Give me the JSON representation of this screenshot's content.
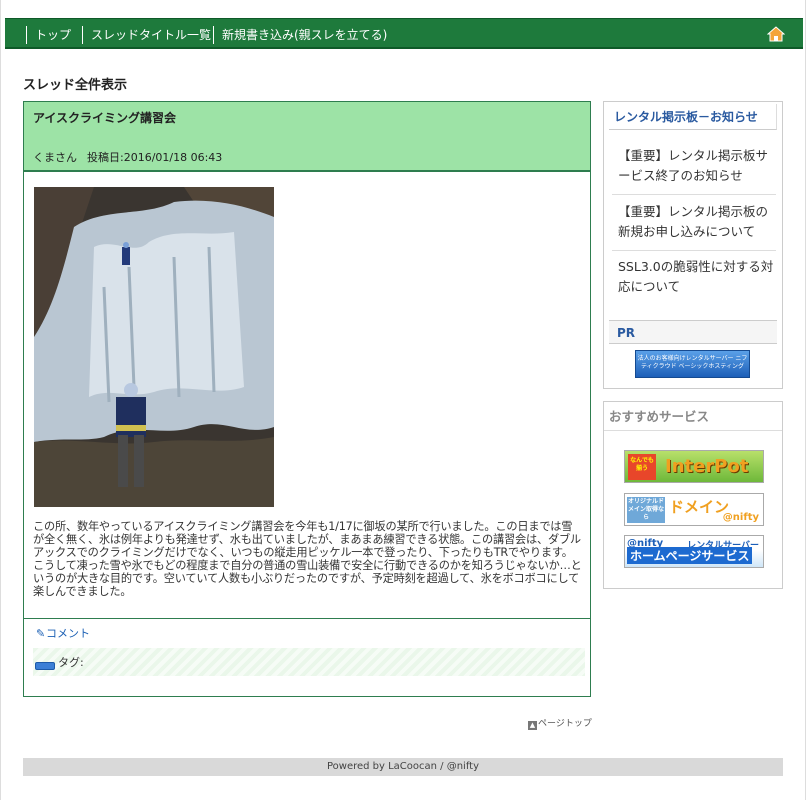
{
  "nav": {
    "items": [
      "トップ",
      "スレッドタイトル一覧",
      "新規書き込み(親スレを立てる)"
    ],
    "home_icon": "home-icon"
  },
  "page": {
    "heading": "スレッド全件表示"
  },
  "thread": {
    "title": "アイスクライミング講習会",
    "author": "くまさん",
    "posted_label": "投稿日:2016/01/18 06:43",
    "body": "この所、数年やっているアイスクライミング講習会を今年も1/17に御坂の某所で行いました。この日までは雪が全く無く、氷は例年よりも発達せず、水も出ていましたが、まあまあ練習できる状態。この講習会は、ダブルアックスでのクライミングだけでなく、いつもの縦走用ピッケル一本で登ったり、下ったりもTRでやります。こうして凍った雪や氷でもどの程度まで自分の普通の雪山装備で安全に行動できるのかを知ろうじゃないか…というのが大きな目的です。空いていて人数も小ぶりだったのですが、予定時刻を超過して、氷をボコボコにして楽しんできました。",
    "comment_label": "コメント",
    "tag_label": "タグ:"
  },
  "pagetop_label": "ページトップ",
  "sidebar": {
    "notice_title": "レンタル掲示板－お知らせ",
    "notices": [
      "【重要】レンタル掲示板サービス終了のお知らせ",
      "【重要】レンタル掲示板の新規お申し込みについて",
      "SSL3.0の脆弱性に対する対応について"
    ],
    "pr_title": "PR",
    "pr_banner_text": "法人のお客様向けレンタルサーバー ニフティクラウド ベーシックホスティング",
    "recommend_title": "おすすめサービス",
    "banners": {
      "interpot": {
        "badge": "なんでも揃う",
        "text": "InterPot"
      },
      "domain": {
        "left": "オリジナルドメイン取得なら",
        "text": "ドメイン",
        "brand": "@nifty"
      },
      "homepage": {
        "brand": "@nifty",
        "right": "レンタルサーバー",
        "text": "ホームページサービス"
      }
    }
  },
  "footer": "Powered by LaCoocan / @nifty",
  "colors": {
    "nav_bg": "#1e7a3c",
    "thread_head_bg": "#9de3a6",
    "thread_border": "#2e7d4f",
    "sidebar_title": "#2a5aa0"
  }
}
